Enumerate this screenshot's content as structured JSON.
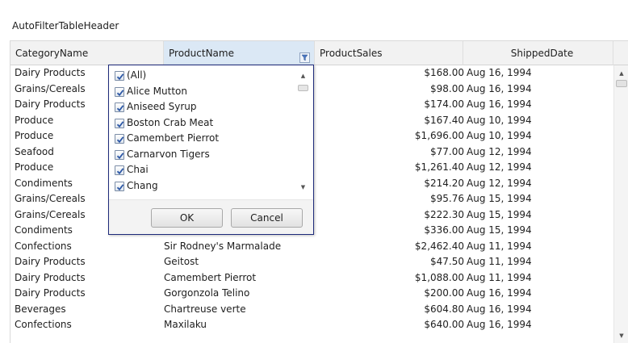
{
  "window": {
    "title": "AutoFilterTableHeader"
  },
  "columns": {
    "category": "CategoryName",
    "product": "ProductName",
    "sales": "ProductSales",
    "date": "ShippedDate"
  },
  "rows": [
    {
      "cat": "Dairy Products",
      "prod": "",
      "sales": "$168.00",
      "date": "Aug 16, 1994"
    },
    {
      "cat": "Grains/Cereals",
      "prod": "",
      "sales": "$98.00",
      "date": "Aug 16, 1994"
    },
    {
      "cat": "Dairy Products",
      "prod": "",
      "sales": "$174.00",
      "date": "Aug 16, 1994"
    },
    {
      "cat": "Produce",
      "prod": "",
      "sales": "$167.40",
      "date": "Aug 10, 1994"
    },
    {
      "cat": "Produce",
      "prod": "",
      "sales": "$1,696.00",
      "date": "Aug 10, 1994"
    },
    {
      "cat": "Seafood",
      "prod": "",
      "sales": "$77.00",
      "date": "Aug 12, 1994"
    },
    {
      "cat": "Produce",
      "prod": "",
      "sales": "$1,261.40",
      "date": "Aug 12, 1994"
    },
    {
      "cat": "Condiments",
      "prod": "",
      "sales": "$214.20",
      "date": "Aug 12, 1994"
    },
    {
      "cat": "Grains/Cereals",
      "prod": "",
      "sales": "$95.76",
      "date": "Aug 15, 1994"
    },
    {
      "cat": "Grains/Cereals",
      "prod": "",
      "sales": "$222.30",
      "date": "Aug 15, 1994"
    },
    {
      "cat": "Condiments",
      "prod": "",
      "sales": "$336.00",
      "date": "Aug 15, 1994"
    },
    {
      "cat": "Confections",
      "prod": "Sir Rodney's Marmalade",
      "sales": "$2,462.40",
      "date": "Aug 11, 1994"
    },
    {
      "cat": "Dairy Products",
      "prod": "Geitost",
      "sales": "$47.50",
      "date": "Aug 11, 1994"
    },
    {
      "cat": "Dairy Products",
      "prod": "Camembert Pierrot",
      "sales": "$1,088.00",
      "date": "Aug 11, 1994"
    },
    {
      "cat": "Dairy Products",
      "prod": "Gorgonzola Telino",
      "sales": "$200.00",
      "date": "Aug 16, 1994"
    },
    {
      "cat": "Beverages",
      "prod": "Chartreuse verte",
      "sales": "$604.80",
      "date": "Aug 16, 1994"
    },
    {
      "cat": "Confections",
      "prod": "Maxilaku",
      "sales": "$640.00",
      "date": "Aug 16, 1994"
    }
  ],
  "filter_popup": {
    "options": [
      {
        "label": "(All)",
        "checked": true
      },
      {
        "label": "Alice Mutton",
        "checked": true
      },
      {
        "label": "Aniseed Syrup",
        "checked": true
      },
      {
        "label": "Boston Crab Meat",
        "checked": true
      },
      {
        "label": "Camembert Pierrot",
        "checked": true
      },
      {
        "label": "Carnarvon Tigers",
        "checked": true
      },
      {
        "label": "Chai",
        "checked": true
      },
      {
        "label": "Chang",
        "checked": true
      }
    ],
    "ok_label": "OK",
    "cancel_label": "Cancel"
  },
  "icons": {
    "filter": "funnel-filter-icon",
    "scroll_up": "scroll-up-arrow-icon",
    "scroll_down": "scroll-down-arrow-icon",
    "checkbox": "checkbox-checked-icon"
  },
  "colors": {
    "active_header": "#dbe8f5",
    "popup_border": "#1e2a7a",
    "header_bg": "#f2f2f2",
    "check_mark": "#2c57a6"
  }
}
